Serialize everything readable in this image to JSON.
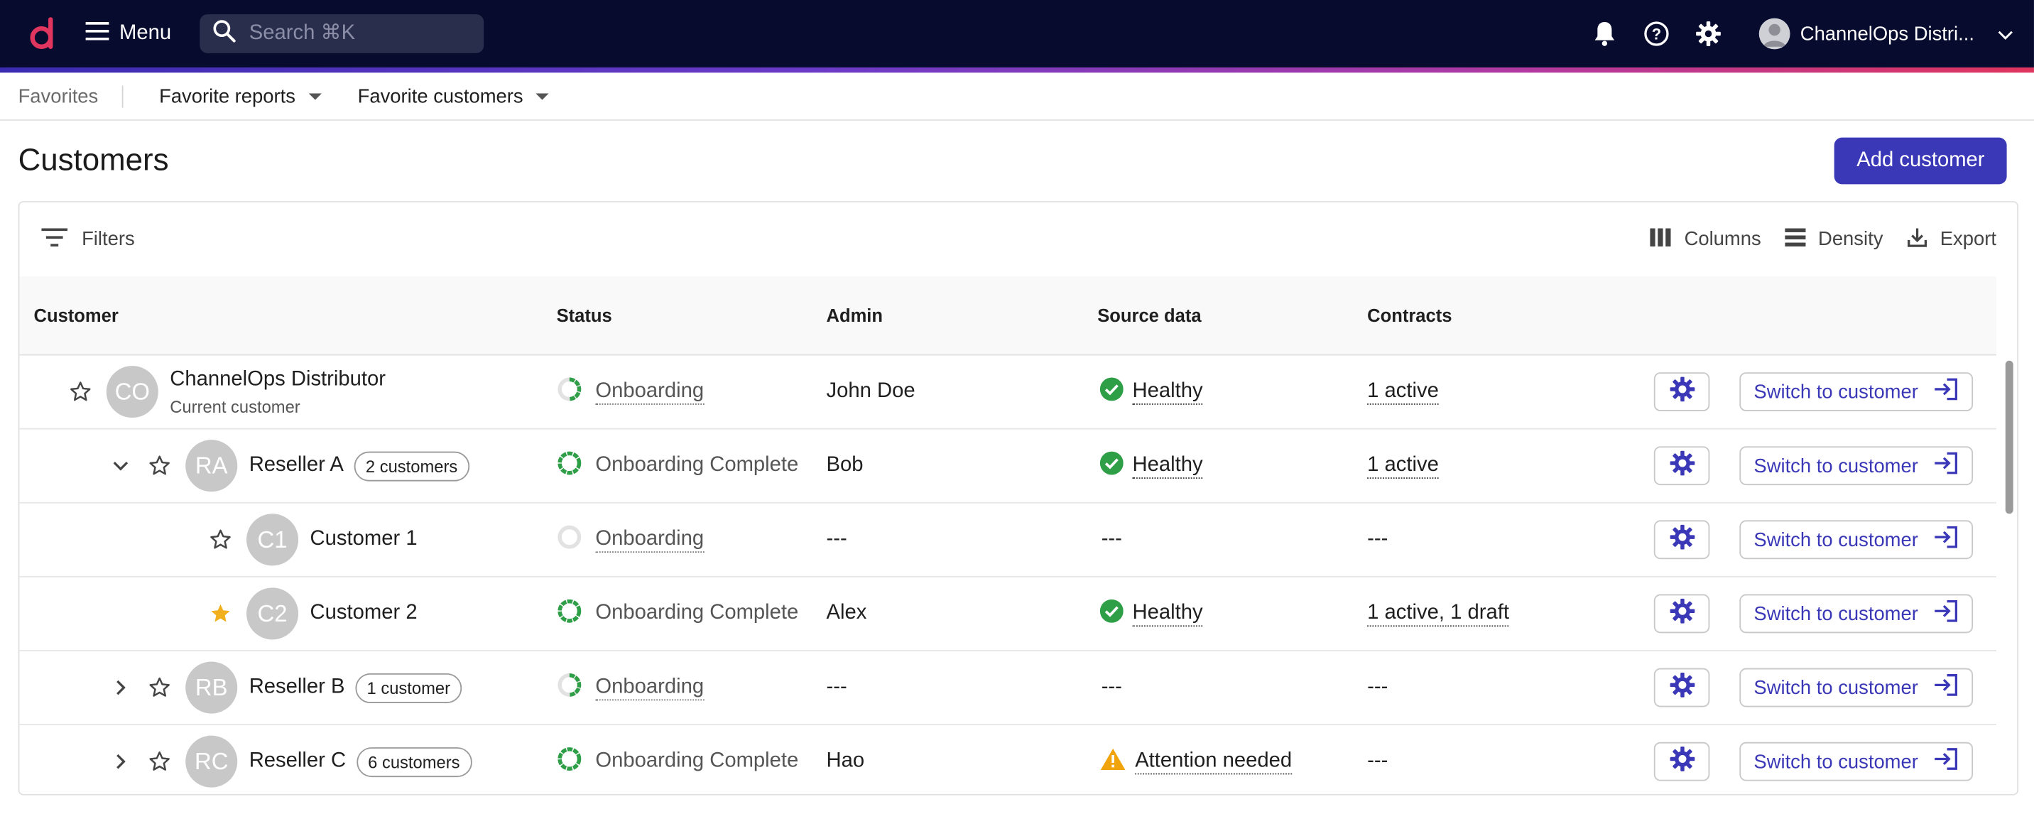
{
  "topbar": {
    "menu_label": "Menu",
    "search_placeholder": "Search ⌘K",
    "account_name": "ChannelOps Distri...",
    "icons": [
      "logo-icon",
      "hamburger-icon",
      "search-icon",
      "bell-icon",
      "help-icon",
      "gear-icon",
      "avatar",
      "chevron-down-icon"
    ]
  },
  "favorites": {
    "title": "Favorites",
    "reports_label": "Favorite reports",
    "customers_label": "Favorite customers"
  },
  "page": {
    "title": "Customers",
    "add_button": "Add customer"
  },
  "toolbar": {
    "filters": "Filters",
    "columns": "Columns",
    "density": "Density",
    "export": "Export"
  },
  "table": {
    "headers": {
      "customer": "Customer",
      "status": "Status",
      "admin": "Admin",
      "source": "Source data",
      "contracts": "Contracts"
    },
    "switch_label": "Switch to customer",
    "rows": [
      {
        "initials": "CO",
        "name": "ChannelOps Distributor",
        "sub": "Current customer",
        "chip": "",
        "starred": false,
        "expand": "none",
        "indent": 0,
        "status": "Onboarding",
        "status_kind": "partial",
        "admin": "John Doe",
        "source": "Healthy",
        "source_kind": "healthy",
        "contracts": "1 active"
      },
      {
        "initials": "RA",
        "name": "Reseller A",
        "sub": "",
        "chip": "2 customers",
        "starred": false,
        "expand": "open",
        "indent": 1,
        "status": "Onboarding Complete",
        "status_kind": "complete",
        "admin": "Bob",
        "source": "Healthy",
        "source_kind": "healthy",
        "contracts": "1 active"
      },
      {
        "initials": "C1",
        "name": "Customer 1",
        "sub": "",
        "chip": "",
        "starred": false,
        "expand": "none",
        "indent": 2,
        "status": "Onboarding",
        "status_kind": "empty",
        "admin": "---",
        "source": "---",
        "source_kind": "none",
        "contracts": "---"
      },
      {
        "initials": "C2",
        "name": "Customer 2",
        "sub": "",
        "chip": "",
        "starred": true,
        "expand": "none",
        "indent": 2,
        "status": "Onboarding Complete",
        "status_kind": "complete",
        "admin": "Alex",
        "source": "Healthy",
        "source_kind": "healthy",
        "contracts": "1 active, 1 draft"
      },
      {
        "initials": "RB",
        "name": "Reseller B",
        "sub": "",
        "chip": "1 customer",
        "starred": false,
        "expand": "closed",
        "indent": 1,
        "status": "Onboarding",
        "status_kind": "partial",
        "admin": "---",
        "source": "---",
        "source_kind": "none",
        "contracts": "---"
      },
      {
        "initials": "RC",
        "name": "Reseller C",
        "sub": "",
        "chip": "6 customers",
        "starred": false,
        "expand": "closed",
        "indent": 1,
        "status": "Onboarding Complete",
        "status_kind": "complete",
        "admin": "Hao",
        "source": "Attention needed",
        "source_kind": "warning",
        "contracts": "---"
      }
    ]
  },
  "colors": {
    "topbar_bg": "#070b2e",
    "accent": "#3b38b8",
    "success": "#2e9e47",
    "warning": "#f0a30a",
    "star_filled": "#f2b01e",
    "logo": "#e0355e"
  }
}
